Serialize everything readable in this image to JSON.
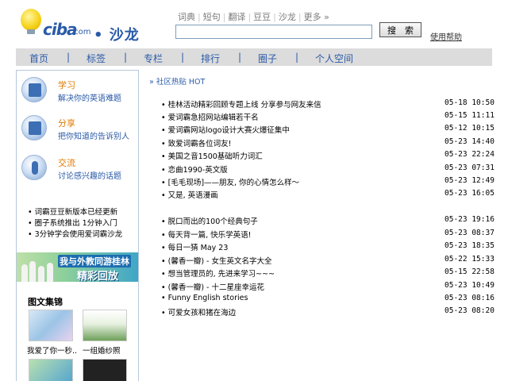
{
  "header": {
    "logo_text": "ciba",
    "logo_domain": ".com",
    "logo_product": "• 沙龙 •",
    "top_links": [
      "词典",
      "短句",
      "翻译",
      "豆豆",
      "沙龙",
      "更多 »"
    ],
    "search_button": "搜 索",
    "help_link": "使用帮助"
  },
  "nav": [
    "首页",
    "标签",
    "专栏",
    "排行",
    "圈子",
    "个人空间"
  ],
  "sidebar": {
    "features": [
      {
        "title": "学习",
        "subtitle": "解决你的英语难题",
        "icon": "study-icon"
      },
      {
        "title": "分享",
        "subtitle": "把你知道的告诉别人",
        "icon": "share-icon"
      },
      {
        "title": "交流",
        "subtitle": "讨论感兴趣的话题",
        "icon": "microphone-icon"
      }
    ],
    "news": [
      "• 词霸豆豆新版本已经更新",
      "• 圈子系统推出 1分钟入门",
      "• 3分钟学会使用爱词霸沙龙"
    ],
    "banner_line1": "我与外教同游桂林",
    "banner_line2": "精彩回放",
    "gallery_title": "图文集锦",
    "gallery_captions": [
      "我爱了你一秒..",
      "一组婚纱照"
    ]
  },
  "main": {
    "section_title": "» 社区热贴 HOT",
    "group1": [
      {
        "title": "• 桂林活动精彩回顾专题上线 分享参与网友来信",
        "date": "05-18 10:50"
      },
      {
        "title": "• 爱词霸急招网站编辑若干名",
        "date": "05-15 11:11"
      },
      {
        "title": "• 爱词霸网站logo设计大赛火爆征集中",
        "date": "05-12 10:15"
      },
      {
        "title": "• 致爱词霸各位词友!",
        "date": "05-23 14:40"
      },
      {
        "title": "• 美国之音1500基础听力词汇",
        "date": "05-23 22:24"
      },
      {
        "title": "• 恋曲1990-英文版",
        "date": "05-23 07:31"
      },
      {
        "title": "• [毛毛现场]——朋友, 你的心情怎么样～",
        "date": "05-23 12:49"
      },
      {
        "title": "• 又是, 英语漫画",
        "date": "05-23 16:05"
      }
    ],
    "group2": [
      {
        "title": "• 脱口而出的100个经典句子",
        "date": "05-23 19:16"
      },
      {
        "title": "• 每天背一篇, 快乐学英语!",
        "date": "05-23 08:37"
      },
      {
        "title": "• 每日一猜 May 23",
        "date": "05-23 18:35"
      },
      {
        "title": "• (馨香一瓣) - 女生英文名字大全",
        "date": "05-22 15:33"
      },
      {
        "title": "• 想当管理员的, 先进来学习~~~",
        "date": "05-15 22:58"
      },
      {
        "title": "• (馨香一瓣) - 十二星座幸运花",
        "date": "05-23 10:49"
      },
      {
        "title": "• Funny English stories",
        "date": "05-23 08:16"
      },
      {
        "title": "• 可爱女孩和猪在海边",
        "date": "05-23 08:20"
      }
    ]
  }
}
